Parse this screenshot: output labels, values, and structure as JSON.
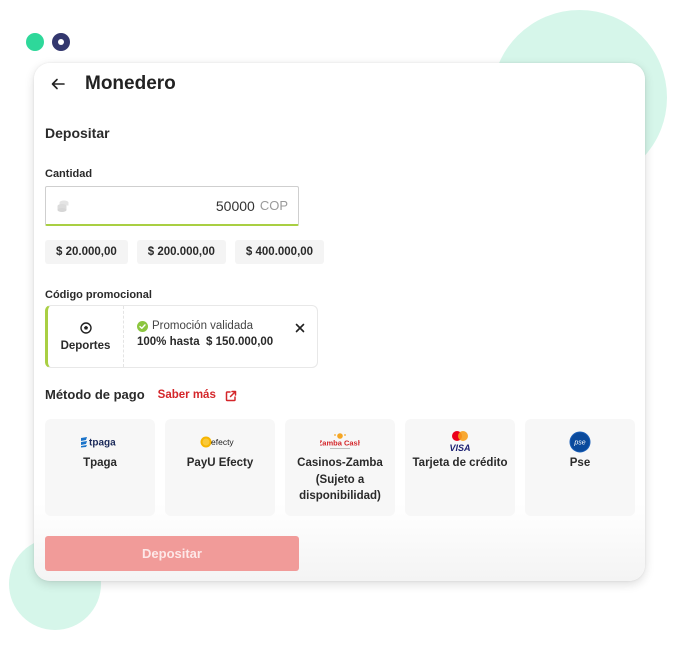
{
  "header": {
    "title": "Monedero"
  },
  "deposit": {
    "section_title": "Depositar",
    "amount_label": "Cantidad",
    "amount_value": "50000",
    "currency": "COP",
    "quick_amounts": [
      "$ 20.000,00",
      "$ 200.000,00",
      "$ 400.000,00"
    ]
  },
  "promo": {
    "label": "Código promocional",
    "category": "Deportes",
    "status": "Promoción validada",
    "detail": "100% hasta  $ 150.000,00"
  },
  "payment": {
    "title": "Método de pago",
    "learn_more": "Saber más",
    "methods": [
      {
        "label": "Tpaga",
        "logo": "tpaga"
      },
      {
        "label": "PayU Efecty",
        "logo": "efecty"
      },
      {
        "label": "Casinos-Zamba (Sujeto a disponibilidad)",
        "logo": "Zamba Cash"
      },
      {
        "label": "Tarjeta de crédito",
        "logo": "VISA"
      },
      {
        "label": "Pse",
        "logo": "pse"
      }
    ]
  },
  "submit": {
    "label": "Depositar"
  },
  "colors": {
    "accent_green": "#a9cf43",
    "link_red": "#d4262a",
    "button_disabled": "#f19b99",
    "blob": "#d6f6ea",
    "dot_green": "#2ed89a",
    "dot_navy": "#33376e"
  }
}
